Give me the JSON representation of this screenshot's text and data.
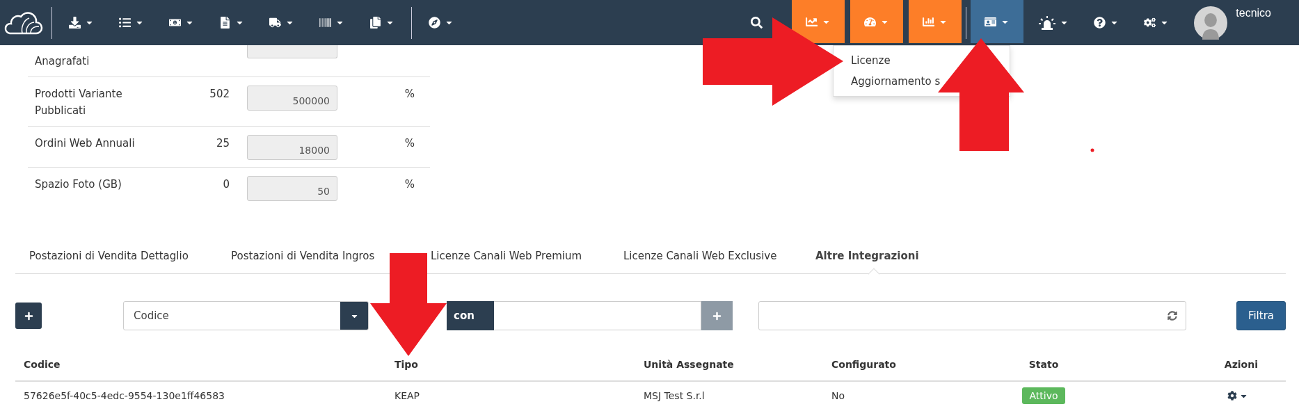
{
  "navbar": {
    "user": "tecnico",
    "menus": [
      {
        "highlighted": false,
        "expanded": false
      },
      {
        "highlighted": true,
        "expanded": false
      },
      {
        "highlighted": true,
        "expanded": false
      },
      {
        "highlighted": true,
        "expanded": false
      },
      {
        "highlighted": false,
        "expanded": true
      },
      {
        "highlighted": false,
        "expanded": false
      },
      {
        "highlighted": false,
        "expanded": false
      },
      {
        "highlighted": false,
        "expanded": false
      }
    ]
  },
  "dropdown": {
    "items": [
      "Licenze",
      "Aggiornamento s"
    ]
  },
  "quota_rows": [
    {
      "label": "Anagrafati"
    },
    {
      "label": "Prodotti Variante Pubblicati",
      "count": "502",
      "limit": "500000",
      "unit": "%"
    },
    {
      "label": "Ordini Web Annuali",
      "count": "25",
      "limit": "18000",
      "unit": "%"
    },
    {
      "label": "Spazio Foto (GB)",
      "count": "0",
      "limit": "50",
      "unit": "%"
    }
  ],
  "tabs": [
    {
      "label": "Postazioni di Vendita Dettaglio",
      "selected": false
    },
    {
      "label": "Postazioni di Vendita Ingros",
      "selected": false
    },
    {
      "label": "Licenze Canali Web Premium",
      "selected": false
    },
    {
      "label": "Licenze Canali Web Exclusive",
      "selected": false
    },
    {
      "label": "Altre Integrazioni",
      "selected": true
    }
  ],
  "filter": {
    "field": "Codice",
    "operator": "con",
    "button": "Filtra"
  },
  "table": {
    "columns": [
      "Codice",
      "Tipo",
      "Unità Assegnate",
      "Configurato",
      "Stato",
      "Azioni"
    ],
    "rows": [
      {
        "codice": "57626e5f-40c5-4edc-9554-130e1ff46583",
        "tipo": "KEAP",
        "unita": "MSJ Test S.r.l",
        "configurato": "No",
        "stato": "Attivo",
        "color": "#5cb85c"
      }
    ]
  },
  "annotations": [
    {
      "kind": "arrow-right"
    },
    {
      "kind": "arrow-up"
    },
    {
      "kind": "arrow-down"
    },
    {
      "kind": "dot"
    }
  ]
}
